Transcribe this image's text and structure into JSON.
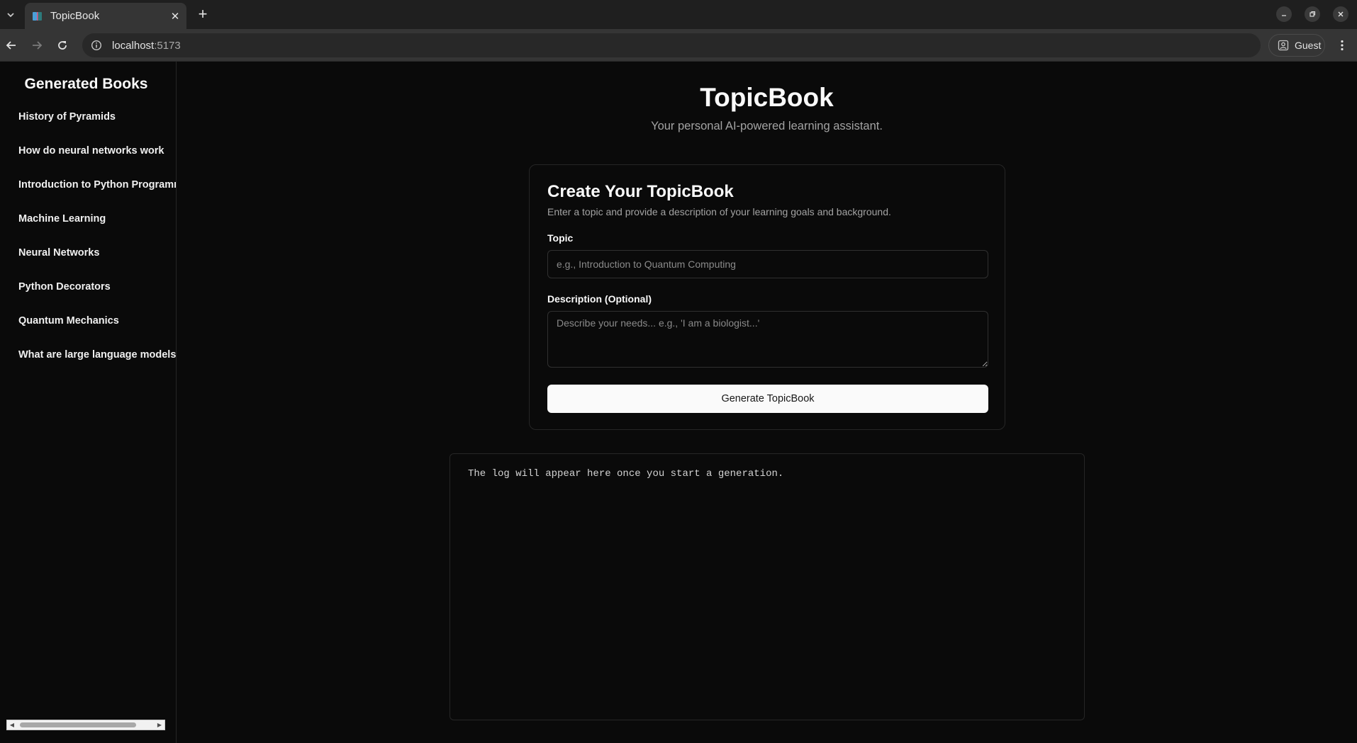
{
  "browser": {
    "tab_title": "TopicBook",
    "url_host": "localhost",
    "url_port": ":5173",
    "profile_label": "Guest"
  },
  "sidebar": {
    "heading": "Generated Books",
    "items": [
      {
        "label": "History of Pyramids"
      },
      {
        "label": "How do neural networks work"
      },
      {
        "label": "Introduction to Python Programming"
      },
      {
        "label": "Machine Learning"
      },
      {
        "label": "Neural Networks"
      },
      {
        "label": "Python Decorators"
      },
      {
        "label": "Quantum Mechanics"
      },
      {
        "label": "What are large language models"
      }
    ]
  },
  "header": {
    "title": "TopicBook",
    "subtitle": "Your personal AI-powered learning assistant."
  },
  "form": {
    "title": "Create Your TopicBook",
    "description": "Enter a topic and provide a description of your learning goals and background.",
    "topic_label": "Topic",
    "topic_placeholder": "e.g., Introduction to Quantum Computing",
    "topic_value": "",
    "description_label": "Description (Optional)",
    "description_placeholder": "Describe your needs... e.g., 'I am a biologist...'",
    "description_value": "",
    "submit_label": "Generate TopicBook"
  },
  "log": {
    "placeholder_text": "The log will appear here once you start a generation."
  },
  "colors": {
    "background": "#0a0a0a",
    "border": "#262626",
    "muted_text": "#a3a3a3",
    "button_bg": "#fafafa",
    "button_text": "#171717"
  }
}
